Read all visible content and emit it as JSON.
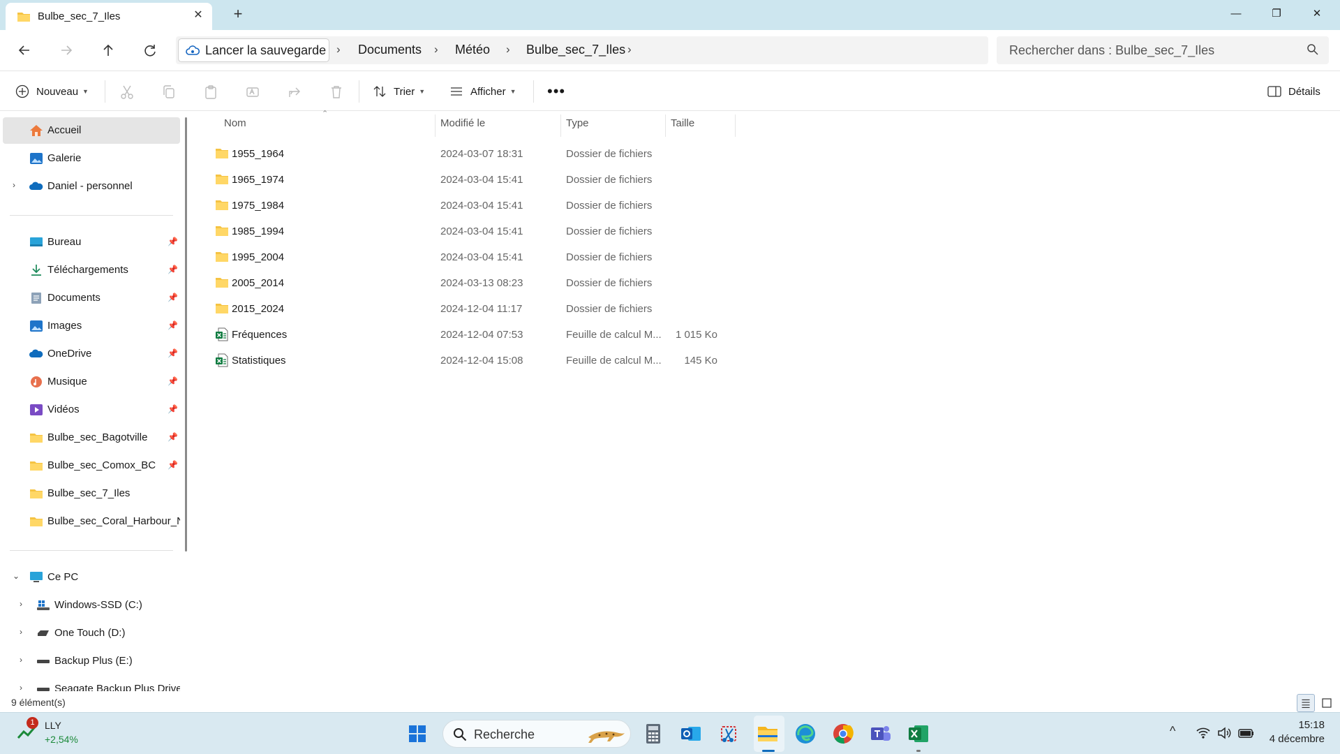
{
  "window": {
    "tab_title": "Bulbe_sec_7_Iles",
    "close_tab_glyph": "✕",
    "new_tab_glyph": "+",
    "minimize_glyph": "—",
    "maximize_glyph": "❐",
    "close_glyph": "✕"
  },
  "address": {
    "backup_label": "Lancer la sauvegarde",
    "crumbs": [
      "Documents",
      "Météo",
      "Bulbe_sec_7_Iles"
    ],
    "search_placeholder": "Rechercher dans : Bulbe_sec_7_Iles"
  },
  "commands": {
    "new_label": "Nouveau",
    "sort_label": "Trier",
    "view_label": "Afficher",
    "details_label": "Détails"
  },
  "sidebar": {
    "top": [
      {
        "label": "Accueil",
        "icon": "home-icon"
      },
      {
        "label": "Galerie",
        "icon": "gallery-icon"
      },
      {
        "label": "Daniel - personnel",
        "icon": "onedrive-icon"
      }
    ],
    "quick": [
      {
        "label": "Bureau",
        "icon": "desktop-icon"
      },
      {
        "label": "Téléchargements",
        "icon": "download-icon"
      },
      {
        "label": "Documents",
        "icon": "documents-icon"
      },
      {
        "label": "Images",
        "icon": "images-icon"
      },
      {
        "label": "OneDrive",
        "icon": "onedrive-icon"
      },
      {
        "label": "Musique",
        "icon": "music-icon"
      },
      {
        "label": "Vidéos",
        "icon": "videos-icon"
      },
      {
        "label": "Bulbe_sec_Bagotville",
        "icon": "folder-icon"
      },
      {
        "label": "Bulbe_sec_Comox_BC",
        "icon": "folder-icon"
      },
      {
        "label": "Bulbe_sec_7_Iles",
        "icon": "folder-icon"
      },
      {
        "label": "Bulbe_sec_Coral_Harbour_NU",
        "icon": "folder-icon"
      }
    ],
    "pc": {
      "label": "Ce PC",
      "icon": "pc-icon"
    },
    "drives": [
      {
        "label": "Windows-SSD (C:)",
        "icon": "windows-drive-icon"
      },
      {
        "label": "One Touch (D:)",
        "icon": "drive-icon"
      },
      {
        "label": "Backup Plus (E:)",
        "icon": "drive-icon"
      },
      {
        "label": "Seagate Backup Plus Drive",
        "icon": "drive-icon"
      }
    ]
  },
  "columns": {
    "name": "Nom",
    "modified": "Modifié le",
    "type": "Type",
    "size": "Taille"
  },
  "files": [
    {
      "name": "1955_1964",
      "modified": "2024-03-07 18:31",
      "type": "Dossier de fichiers",
      "size": "",
      "icon": "folder-icon"
    },
    {
      "name": "1965_1974",
      "modified": "2024-03-04 15:41",
      "type": "Dossier de fichiers",
      "size": "",
      "icon": "folder-icon"
    },
    {
      "name": "1975_1984",
      "modified": "2024-03-04 15:41",
      "type": "Dossier de fichiers",
      "size": "",
      "icon": "folder-icon"
    },
    {
      "name": "1985_1994",
      "modified": "2024-03-04 15:41",
      "type": "Dossier de fichiers",
      "size": "",
      "icon": "folder-icon"
    },
    {
      "name": "1995_2004",
      "modified": "2024-03-04 15:41",
      "type": "Dossier de fichiers",
      "size": "",
      "icon": "folder-icon"
    },
    {
      "name": "2005_2014",
      "modified": "2024-03-13 08:23",
      "type": "Dossier de fichiers",
      "size": "",
      "icon": "folder-icon"
    },
    {
      "name": "2015_2024",
      "modified": "2024-12-04 11:17",
      "type": "Dossier de fichiers",
      "size": "",
      "icon": "folder-icon"
    },
    {
      "name": "Fréquences",
      "modified": "2024-12-04 07:53",
      "type": "Feuille de calcul M...",
      "size": "1 015 Ko",
      "icon": "excel-file-icon"
    },
    {
      "name": "Statistiques",
      "modified": "2024-12-04 15:08",
      "type": "Feuille de calcul M...",
      "size": "145 Ko",
      "icon": "excel-file-icon"
    }
  ],
  "status": {
    "count": "9 élément(s)"
  },
  "taskbar": {
    "stock_ticker": "LLY",
    "stock_change": "+2,54%",
    "stock_badge": "1",
    "search_placeholder": "Recherche",
    "time": "15:18",
    "date": "4 décembre"
  }
}
